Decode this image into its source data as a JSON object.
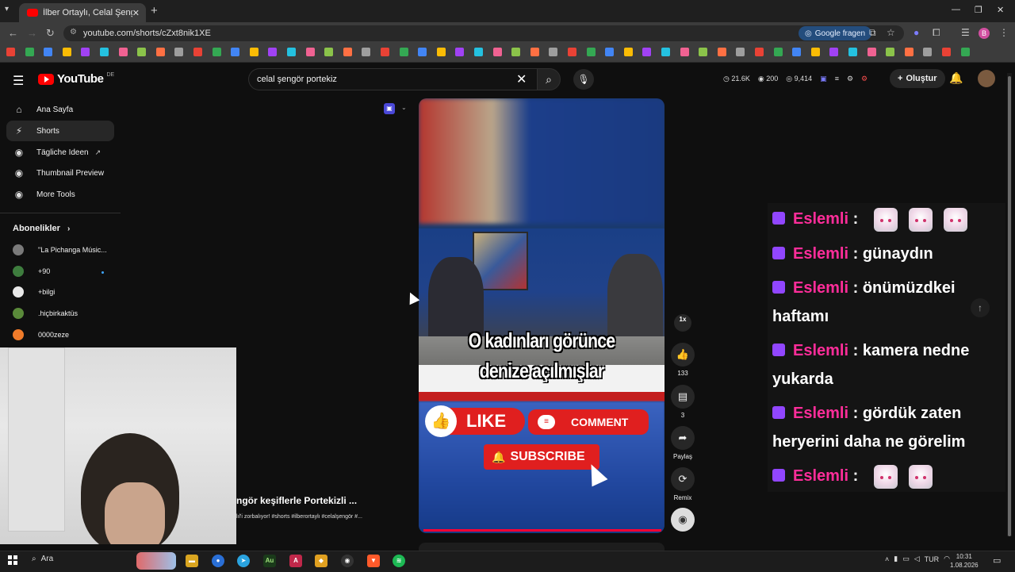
{
  "browser": {
    "tab_title": "İlber Ortaylı, Celal Şengör keşifl...",
    "url": "youtube.com/shorts/cZxt8nik1XE",
    "google_fragen": "Google fragen",
    "profile_initial": "B",
    "tab_list_icon": "chevron-down-icon",
    "new_tab_icon": "plus-icon"
  },
  "youtube": {
    "logo_text": "YouTube",
    "country": "DE",
    "search_query": "celal şengör portekiz",
    "stats": [
      "21.6K",
      "200",
      "9,414"
    ],
    "create_label": "Oluştur"
  },
  "sidebar": {
    "items": [
      {
        "label": "Ana Sayfa",
        "icon": "home-icon"
      },
      {
        "label": "Shorts",
        "icon": "shorts-icon"
      },
      {
        "label": "Tägliche Ideen",
        "icon": "idea-icon"
      },
      {
        "label": "Thumbnail Preview",
        "icon": "thumbnail-icon"
      },
      {
        "label": "More Tools",
        "icon": "tools-icon"
      }
    ],
    "subscriptions_heading": "Abonelikler",
    "subscriptions": [
      {
        "label": "\"La Pichanga Músic...",
        "color": "#7a7a7a"
      },
      {
        "label": "+90",
        "color": "#3e7d3e"
      },
      {
        "label": "+bilgi",
        "color": "#e8e8e8"
      },
      {
        "label": ".hiçbirkaktüs",
        "color": "#5a8a3a"
      },
      {
        "label": "0000zeze",
        "color": "#f07b2a"
      }
    ]
  },
  "short": {
    "title": "ngör keşiflerle Portekizli ...",
    "tags": "lıl'i zorbalıyor! #shorts #ilberortaylı #celalşengör #...",
    "caption_line1": "O kadınları görünce",
    "caption_line2": "denize açılmışlar",
    "like_label": "LIKE",
    "comment_label": "COMMENT",
    "subscribe_label": "SUBSCRIBE"
  },
  "actions": {
    "speed": "1x",
    "like_count": "133",
    "comment_count": "3",
    "share_label": "Paylaş",
    "remix_label": "Remix"
  },
  "chat": [
    {
      "user": "Eslemli",
      "message": "",
      "emotes": 3
    },
    {
      "user": "Eslemli",
      "message": "günaydın",
      "emotes": 0
    },
    {
      "user": "Eslemli",
      "message": "önümüzdkei haftamı",
      "emotes": 0
    },
    {
      "user": "Eslemli",
      "message": "kamera nedne yukarda",
      "emotes": 0
    },
    {
      "user": "Eslemli",
      "message": "gördük zaten heryerini daha ne görelim",
      "emotes": 0
    },
    {
      "user": "Eslemli",
      "message": "",
      "emotes": 2
    }
  ],
  "taskbar": {
    "search_label": "Ara",
    "language": "TUR",
    "time": "10:31",
    "date": "1.08.2026"
  },
  "colors": {
    "accent_red": "#e01f1f",
    "chat_user": "#ff2d9a",
    "twitch_purple": "#9146ff"
  }
}
